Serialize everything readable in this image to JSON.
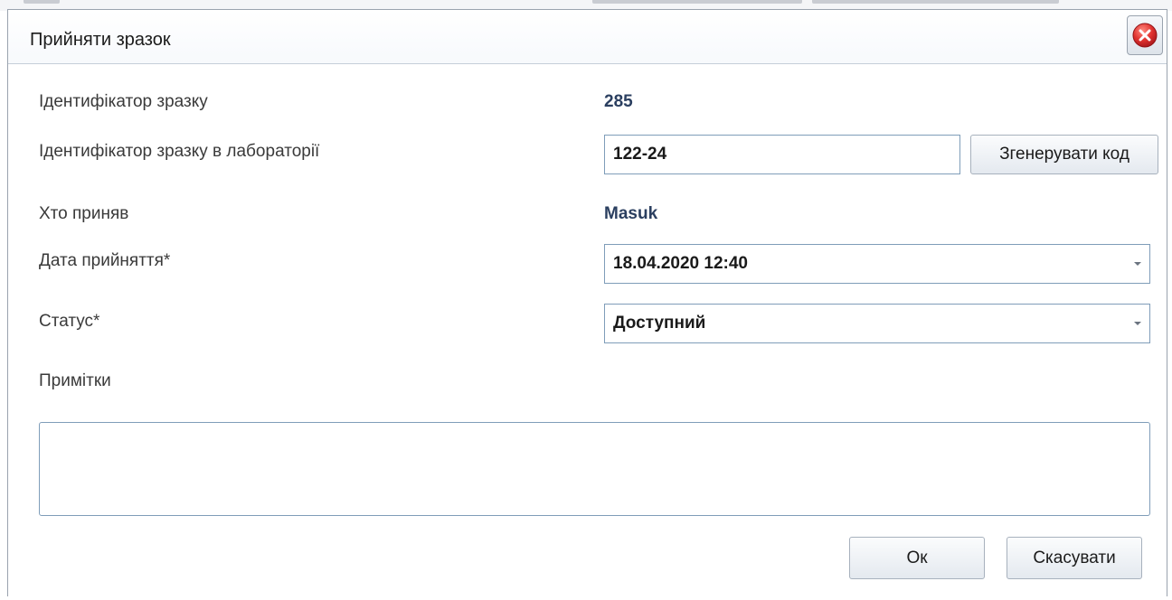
{
  "dialog": {
    "title": "Прийняти зразок"
  },
  "form": {
    "sample_id": {
      "label": "Ідентифікатор зразку",
      "value": "285"
    },
    "lab_sample_id": {
      "label": "Ідентифікатор зразку в лабораторії",
      "value": "122-24",
      "generate_button": "Згенерувати код"
    },
    "received_by": {
      "label": "Хто приняв",
      "value": "Masuk"
    },
    "accept_date": {
      "label": "Дата прийняття*",
      "value": "18.04.2020 12:40"
    },
    "status": {
      "label": "Статус*",
      "value": "Доступний"
    },
    "notes": {
      "label": "Примітки",
      "value": ""
    }
  },
  "buttons": {
    "ok": "Ок",
    "cancel": "Скасувати"
  },
  "icons": {
    "close": "close-icon",
    "dropdown": "chevron-down-icon"
  },
  "colors": {
    "value_text": "#2b3f60",
    "close_red": "#d9262b",
    "input_border": "#7f9db9"
  }
}
